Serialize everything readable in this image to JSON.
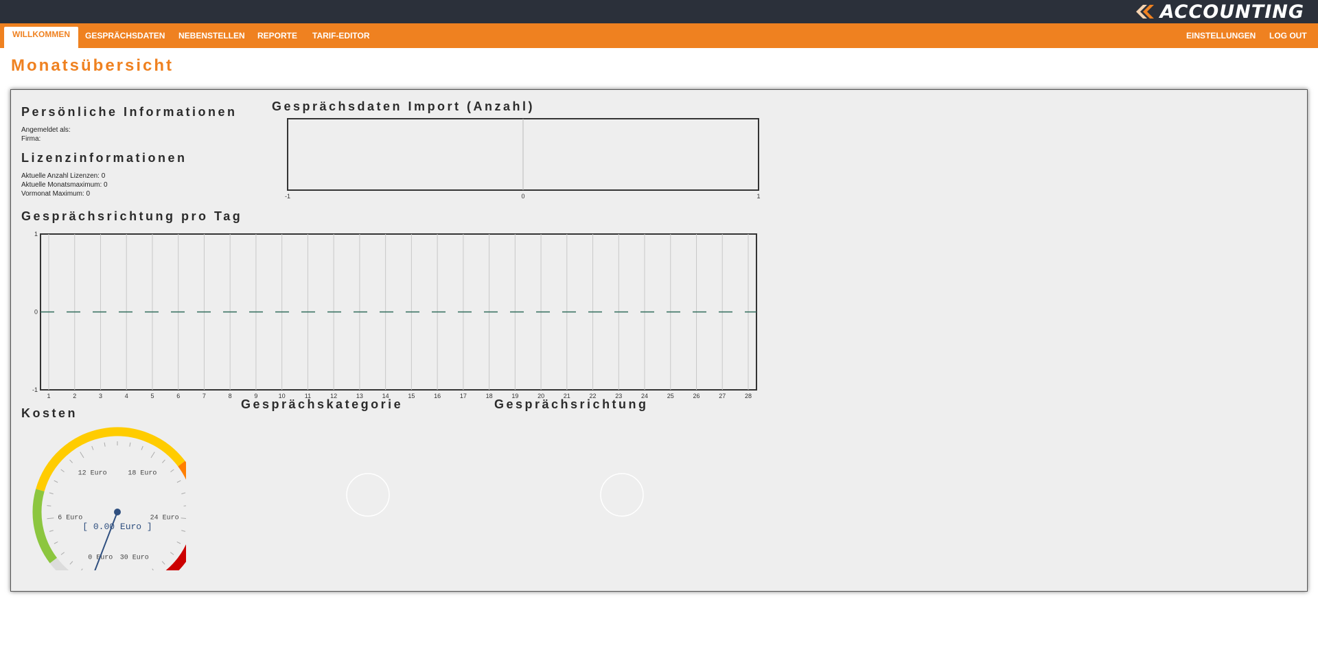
{
  "app": {
    "logo_text": "ACCOUNTING",
    "logo_icon": "double-chevron-left-icon",
    "colors": {
      "topbar": "#2b303a",
      "accent": "#ef8120",
      "panel": "#eeeeee"
    }
  },
  "nav": {
    "left": [
      {
        "label": "WILLKOMMEN",
        "active": true
      },
      {
        "label": "GESPRÄCHSDATEN",
        "active": false
      },
      {
        "label": "NEBENSTELLEN",
        "active": false
      },
      {
        "label": "REPORTE",
        "active": false
      },
      {
        "label": "TARIF-EDITOR",
        "active": false
      }
    ],
    "right": [
      {
        "label": "EINSTELLUNGEN"
      },
      {
        "label": "LOG OUT"
      }
    ]
  },
  "page": {
    "title": "Monatsübersicht"
  },
  "personal": {
    "heading": "Persönliche Informationen",
    "logged_in_as": "Angemeldet als:",
    "company": "Firma:"
  },
  "license": {
    "heading": "Lizenzinformationen",
    "current_count": "Aktuelle Anzahl Lizenzen: 0",
    "month_max": "Aktuelle Monatsmaximum: 0",
    "prev_month_max": "Vormonat Maximum: 0"
  },
  "import_chart": {
    "heading": "Gesprächsdaten Import (Anzahl)"
  },
  "direction_day_chart": {
    "heading": "Gesprächsrichtung pro Tag"
  },
  "costs": {
    "heading": "Kosten"
  },
  "category": {
    "heading": "Gesprächskategorie"
  },
  "direction": {
    "heading": "Gesprächsrichtung"
  },
  "chart_data": [
    {
      "type": "bar",
      "title": "Gesprächsdaten Import (Anzahl)",
      "x_ticks": [
        "-1",
        "0",
        "1"
      ],
      "xlim": [
        -1,
        1
      ],
      "series": []
    },
    {
      "type": "line",
      "title": "Gesprächsrichtung pro Tag",
      "categories": [
        "1",
        "2",
        "3",
        "4",
        "5",
        "6",
        "7",
        "8",
        "9",
        "10",
        "11",
        "12",
        "13",
        "14",
        "15",
        "16",
        "17",
        "18",
        "19",
        "20",
        "21",
        "22",
        "23",
        "24",
        "25",
        "26",
        "27",
        "28"
      ],
      "y_ticks": [
        "1",
        "0",
        "-1"
      ],
      "ylim": [
        -1,
        1
      ],
      "grid": true,
      "series": [
        {
          "values": [
            0,
            0,
            0,
            0,
            0,
            0,
            0,
            0,
            0,
            0,
            0,
            0,
            0,
            0,
            0,
            0,
            0,
            0,
            0,
            0,
            0,
            0,
            0,
            0,
            0,
            0,
            0,
            0
          ],
          "color": "#2f6b5a",
          "dashed": true
        }
      ]
    },
    {
      "type": "gauge",
      "title": "Kosten",
      "min": 0,
      "max": 30,
      "value": 0,
      "value_label": "[ 0.00 Euro ]",
      "tick_labels": [
        "0 Euro",
        "6 Euro",
        "12 Euro",
        "18 Euro",
        "24 Euro",
        "30 Euro"
      ],
      "bands": [
        {
          "from": 0,
          "to": 3,
          "color": "#dcdcdc"
        },
        {
          "from": 3,
          "to": 8,
          "color": "#8cc63f"
        },
        {
          "from": 8,
          "to": 20,
          "color": "#ffcc00"
        },
        {
          "from": 20,
          "to": 25,
          "color": "#ff7f00"
        },
        {
          "from": 25,
          "to": 30,
          "color": "#cc0000"
        }
      ]
    },
    {
      "type": "pie",
      "title": "Gesprächskategorie",
      "slices": []
    },
    {
      "type": "pie",
      "title": "Gesprächsrichtung",
      "slices": []
    }
  ]
}
